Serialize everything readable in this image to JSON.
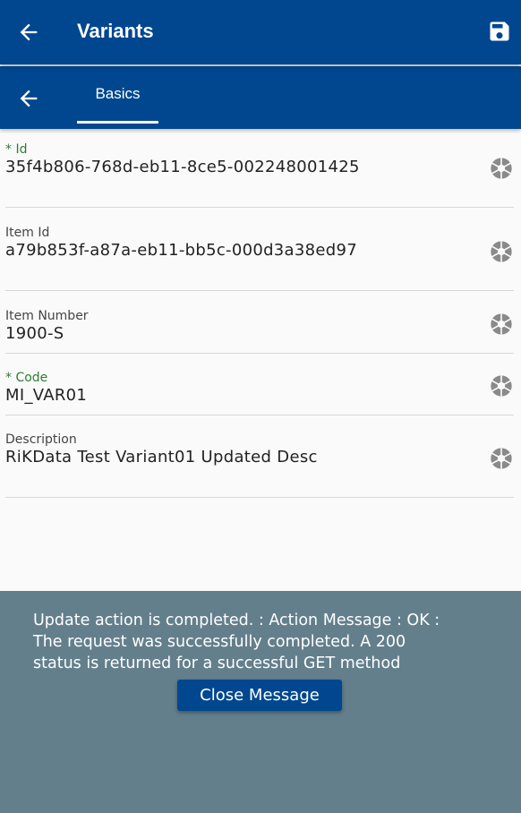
{
  "header": {
    "title": "Variants",
    "back_icon": "arrow-left-icon",
    "save_icon": "floppy-disk-icon"
  },
  "tabs": {
    "back_icon": "arrow-left-icon",
    "active": "Basics"
  },
  "fields": [
    {
      "label": "* Id",
      "required": true,
      "value": "35f4b806-768d-eb11-8ce5-002248001425",
      "icon": "camera-shutter-icon"
    },
    {
      "label": "Item Id",
      "required": false,
      "value": "a79b853f-a87a-eb11-bb5c-000d3a38ed97",
      "icon": "camera-shutter-icon"
    },
    {
      "label": "Item Number",
      "required": false,
      "value": "1900-S",
      "icon": "camera-shutter-icon"
    },
    {
      "label": "* Code",
      "required": true,
      "value": "MI_VAR01",
      "icon": "camera-shutter-icon"
    },
    {
      "label": "Description",
      "required": false,
      "value": "RiKData Test Variant01 Updated Desc",
      "icon": "camera-shutter-icon"
    }
  ],
  "message": {
    "line1": "Update action is completed.  : Action Message : OK :",
    "line2": "The request was successfully completed. A 200",
    "line3": "status is returned for a successful GET method",
    "close_label": "Close Message"
  },
  "colors": {
    "brand": "#00478f",
    "required_label": "#2e7d32",
    "message_bg": "#637f8c"
  }
}
